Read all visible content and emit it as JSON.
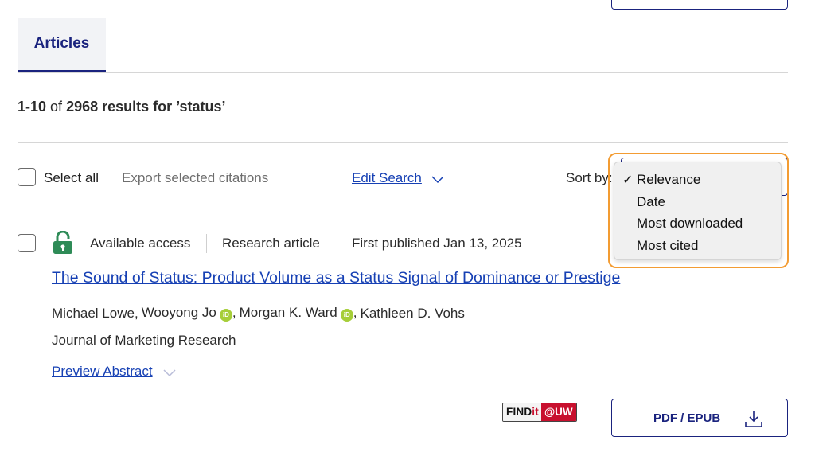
{
  "tabs": [
    {
      "label": "Articles",
      "active": true
    }
  ],
  "results": {
    "range": "1-10",
    "of": "of",
    "count": "2968",
    "suffix": "results for",
    "query": "’status’"
  },
  "toolbar": {
    "select_all": "Select all",
    "export": "Export selected citations",
    "edit_search": "Edit Search",
    "sort_label": "Sort by:"
  },
  "sort": {
    "selected": "Relevance",
    "check": "✓",
    "options": [
      "Relevance",
      "Date",
      "Most downloaded",
      "Most cited"
    ]
  },
  "article": {
    "access": "Available access",
    "type": "Research article",
    "published": "First published Jan 13, 2025",
    "title": "The Sound of Status: Product Volume as a Status Signal of Dominance or Prestige",
    "authors": [
      {
        "name": "Michael Lowe",
        "orcid": false
      },
      {
        "name": "Wooyong Jo",
        "orcid": true
      },
      {
        "name": "Morgan K. Ward",
        "orcid": true
      },
      {
        "name": "Kathleen D. Vohs",
        "orcid": false
      }
    ],
    "author_sep": ",",
    "orcid_label": "iD",
    "journal": "Journal of Marketing Research",
    "preview": "Preview Abstract",
    "findit_left": "FIND",
    "findit_it": "it",
    "findit_right": "@UW",
    "pdf_button": "PDF / EPUB"
  },
  "colors": {
    "brand": "#1a237e",
    "link": "#1640b4",
    "focus": "#f39c33",
    "lock": "#2e8b57",
    "orcid": "#a6ce39"
  }
}
